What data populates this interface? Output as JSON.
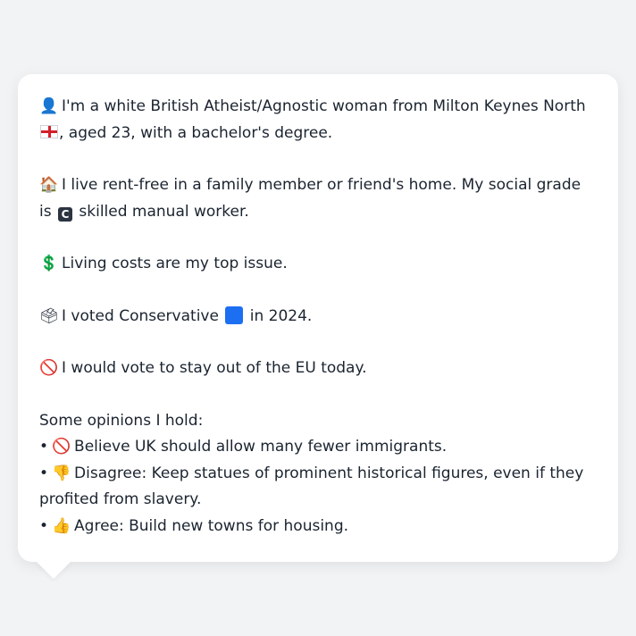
{
  "profile": {
    "intro": {
      "icon": "person-silhouette-icon",
      "icon_glyph": "👤",
      "text_before_flag": "I'm a white British Atheist/Agnostic woman from Milton Keynes North",
      "flag_icon": "england-flag-icon",
      "text_after_flag": ", aged 23, with a bachelor's degree."
    },
    "housing": {
      "icon": "house-icon",
      "icon_glyph": "🏠",
      "text_before_badge": "I live rent-free in a family member or friend's home. My social grade is",
      "grade_badge": "C",
      "text_after_badge": "skilled manual worker."
    },
    "issue": {
      "icon": "dollar-sign-icon",
      "icon_glyph": "💲",
      "text": "Living costs are my top issue."
    },
    "vote": {
      "icon": "ballot-box-icon",
      "icon_glyph": "🗳",
      "text_before_square": "I voted Conservative",
      "party_color": "#1d6ff2",
      "text_after_square": "in 2024."
    },
    "eu": {
      "icon": "prohibited-icon",
      "icon_glyph": "🚫",
      "text": "I would vote to stay out of the EU today."
    },
    "opinions": {
      "heading": "Some opinions I hold:",
      "items": [
        {
          "bullet": "•",
          "icon": "prohibited-icon",
          "icon_glyph": "🚫",
          "text": "Believe UK should allow many fewer immigrants."
        },
        {
          "bullet": "•",
          "icon": "thumbs-down-icon",
          "icon_glyph": "👎",
          "text": "Disagree: Keep statues of prominent historical figures, even if they profited from slavery."
        },
        {
          "bullet": "•",
          "icon": "thumbs-up-icon",
          "icon_glyph": "👍",
          "text": "Agree: Build new towns for housing."
        }
      ]
    }
  },
  "colors": {
    "background": "#f2f3f5",
    "bubble": "#ffffff",
    "text": "#1b2430"
  }
}
